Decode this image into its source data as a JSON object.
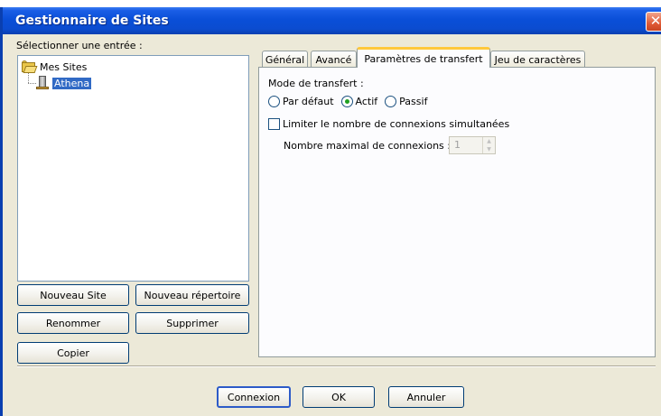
{
  "window": {
    "title": "Gestionnaire de Sites",
    "close_symbol": "✕"
  },
  "left": {
    "select_label": "Sélectionner une entrée :",
    "tree": {
      "root": "Mes Sites",
      "children": [
        {
          "label": "Athena"
        }
      ]
    },
    "buttons": {
      "new_site": "Nouveau Site",
      "new_folder": "Nouveau répertoire",
      "rename": "Renommer",
      "delete": "Supprimer",
      "copy": "Copier"
    }
  },
  "tabs": [
    {
      "label": "Général"
    },
    {
      "label": "Avancé"
    },
    {
      "label": "Paramètres de transfert"
    },
    {
      "label": "Jeu de caractères"
    }
  ],
  "transfer": {
    "mode_label": "Mode de transfert :",
    "options": [
      {
        "label": "Par défaut",
        "checked": false
      },
      {
        "label": "Actif",
        "checked": true
      },
      {
        "label": "Passif",
        "checked": false
      }
    ],
    "limit_label": "Limiter le nombre de connexions simultanées",
    "limit_checked": false,
    "max_label": "Nombre maximal de connexions :",
    "max_value": "1"
  },
  "footer": {
    "connect": "Connexion",
    "ok": "OK",
    "cancel": "Annuler"
  },
  "colors": {
    "title_bar": "#0a4fd8",
    "window_bg": "#ece9d8",
    "tab_accent": "#ffc83c"
  }
}
